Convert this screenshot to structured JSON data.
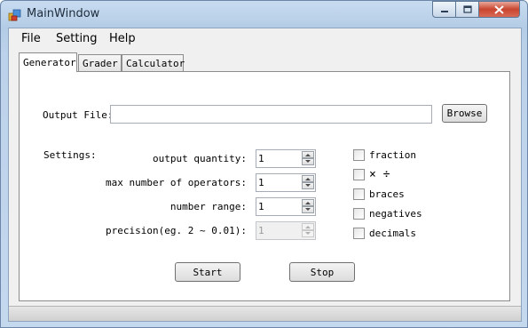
{
  "window": {
    "title": "MainWindow"
  },
  "menu": {
    "file": "File",
    "setting": "Setting",
    "help": "Help"
  },
  "tabs": {
    "generator": "Generator",
    "grader": "Grader",
    "calculator": "Calculator"
  },
  "generator": {
    "output_file_label": "Output File:",
    "output_file_value": "",
    "browse_label": "Browse",
    "settings_label": "Settings:",
    "output_quantity_label": "output quantity:",
    "output_quantity_value": "1",
    "max_operators_label": "max number of operators:",
    "max_operators_value": "1",
    "number_range_label": "number range:",
    "number_range_value": "1",
    "precision_label": "precision(eg. 2 ~ 0.01):",
    "precision_value": "1",
    "options": {
      "fraction": "fraction",
      "muldiv": "× ÷",
      "braces": "braces",
      "negatives": "negatives",
      "decimals": "decimals"
    },
    "start_label": "Start",
    "stop_label": "Stop"
  }
}
